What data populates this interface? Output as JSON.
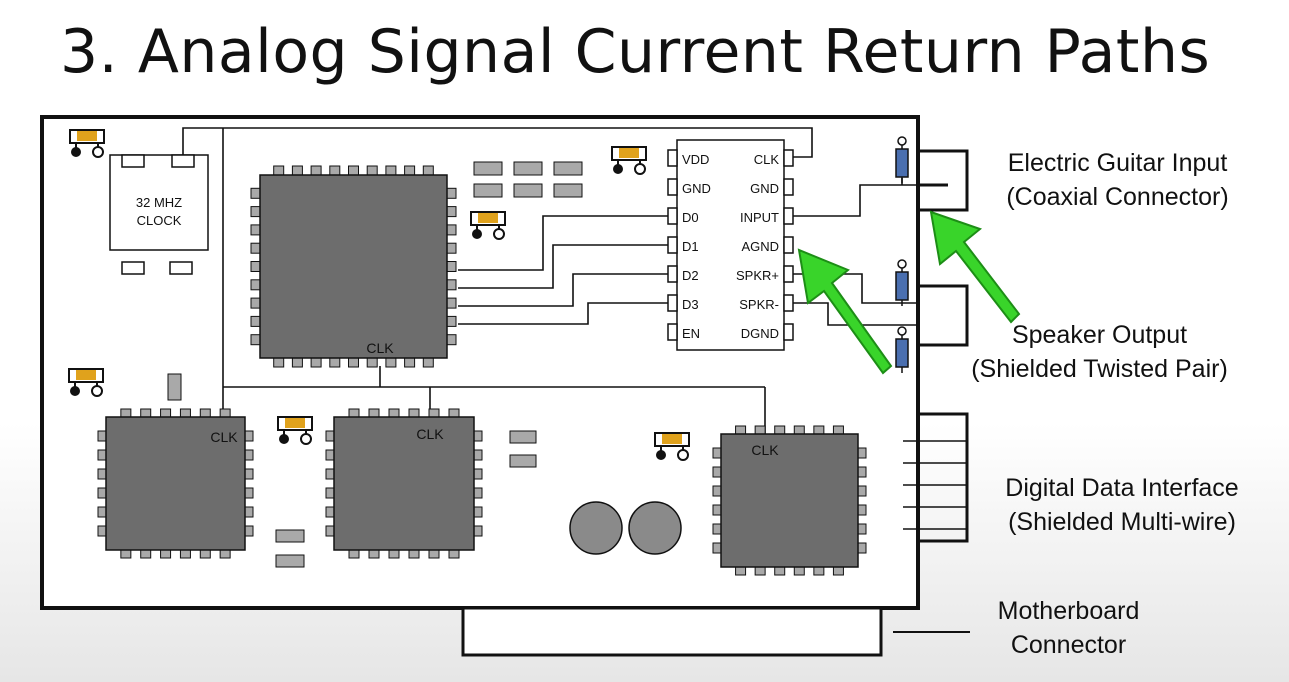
{
  "title": "3. Analog Signal Current Return Paths",
  "board": {
    "clock_osc_line1": "32 MHZ",
    "clock_osc_line2": "CLOCK",
    "clk": "CLK"
  },
  "adc_chip": {
    "left_pins": [
      "VDD",
      "GND",
      "D0",
      "D1",
      "D2",
      "D3",
      "EN"
    ],
    "right_pins": [
      "CLK",
      "GND",
      "INPUT",
      "AGND",
      "SPKR+",
      "SPKR-",
      "DGND"
    ]
  },
  "callouts": {
    "guitar_input": {
      "line1": "Electric Guitar Input",
      "line2": "(Coaxial Connector)"
    },
    "speaker_output": {
      "line1": "Speaker Output",
      "line2": "(Shielded Twisted Pair)"
    },
    "digital_interface": {
      "line1": "Digital Data Interface",
      "line2": "(Shielded Multi-wire)"
    },
    "motherboard": {
      "line1": "Motherboard",
      "line2": "Connector"
    }
  },
  "colors": {
    "chip_fill": "#6d6d6d",
    "pad_fill": "#a9a9a9",
    "arrow_green": "#39d42a",
    "resistor_blue": "#4a6fb0",
    "cap_orange": "#e0a21c"
  }
}
